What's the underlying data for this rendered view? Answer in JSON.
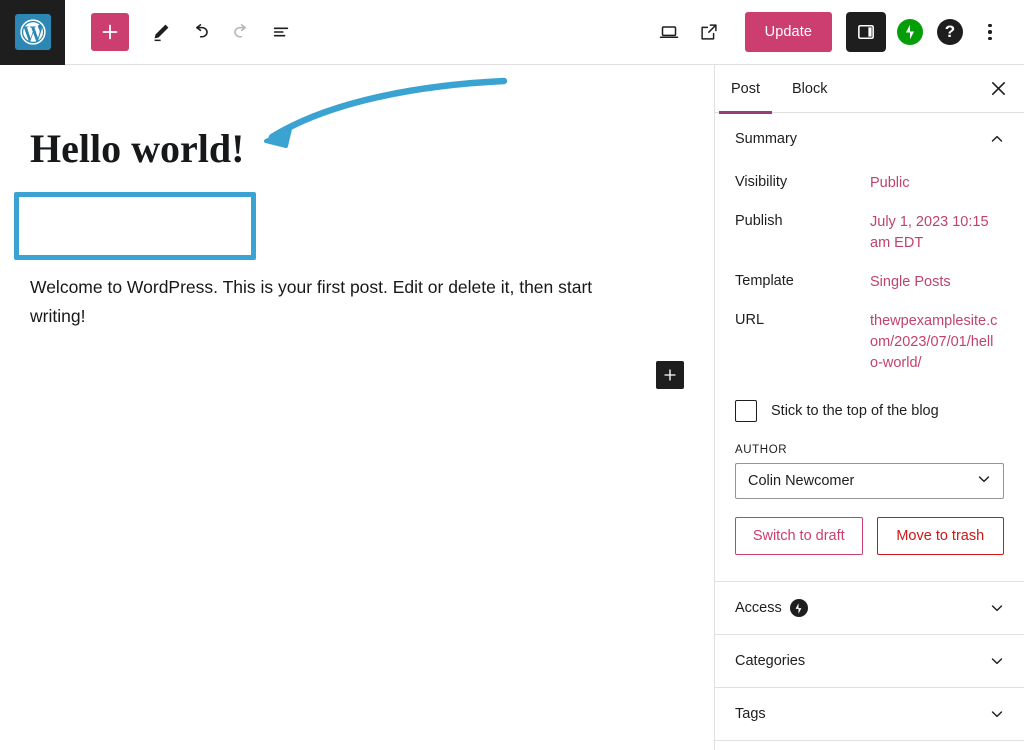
{
  "toolbar": {
    "wp_logo_title": "WordPress",
    "add_block_label": "+",
    "add_block_icon": "plus-icon",
    "edit_icon": "pencil-icon",
    "undo_icon": "undo-icon",
    "redo_icon": "redo-icon",
    "outline_icon": "document-outline-icon",
    "preview_icon": "desktop-preview-icon",
    "view_icon": "external-link-icon",
    "update_label": "Update",
    "settings_icon": "sidebar-settings-icon",
    "jetpack_icon": "jetpack-icon",
    "help_icon": "help-icon",
    "options_icon": "kebab-menu-icon",
    "update_bg": "#cc3e6f",
    "jetpack_color": "#069e08"
  },
  "canvas": {
    "post_title": "Hello world!",
    "post_body": "Welcome to WordPress. This is your first post. Edit or delete it, then start writing!",
    "inserter_icon": "plus-icon",
    "annotation": {
      "highlight_color": "#3ba3d2",
      "arrow_icon": "curved-arrow-icon"
    }
  },
  "sidebar": {
    "tabs": [
      {
        "label": "Post",
        "active": true
      },
      {
        "label": "Block",
        "active": false
      }
    ],
    "close_icon": "close-icon",
    "accent_color": "#9b3d78",
    "link_color": "#c0436b",
    "summary": {
      "title": "Summary",
      "chevron_icon": "chevron-up-icon",
      "rows": [
        {
          "label": "Visibility",
          "value": "Public"
        },
        {
          "label": "Publish",
          "value": "July 1, 2023 10:15 am EDT"
        },
        {
          "label": "Template",
          "value": "Single Posts"
        },
        {
          "label": "URL",
          "value": "thewpexamplesite.com/2023/07/01/hello-world/"
        }
      ],
      "sticky_label": "Stick to the top of the blog",
      "sticky_checked": false,
      "author_label": "AUTHOR",
      "author_value": "Colin Newcomer",
      "author_chevron_icon": "chevron-down-icon",
      "switch_draft_label": "Switch to draft",
      "move_trash_label": "Move to trash"
    },
    "panels": [
      {
        "label": "Access",
        "badge": "jetpack-icon",
        "chevron_icon": "chevron-down-icon"
      },
      {
        "label": "Categories",
        "badge": null,
        "chevron_icon": "chevron-down-icon"
      },
      {
        "label": "Tags",
        "badge": null,
        "chevron_icon": "chevron-down-icon"
      }
    ]
  }
}
